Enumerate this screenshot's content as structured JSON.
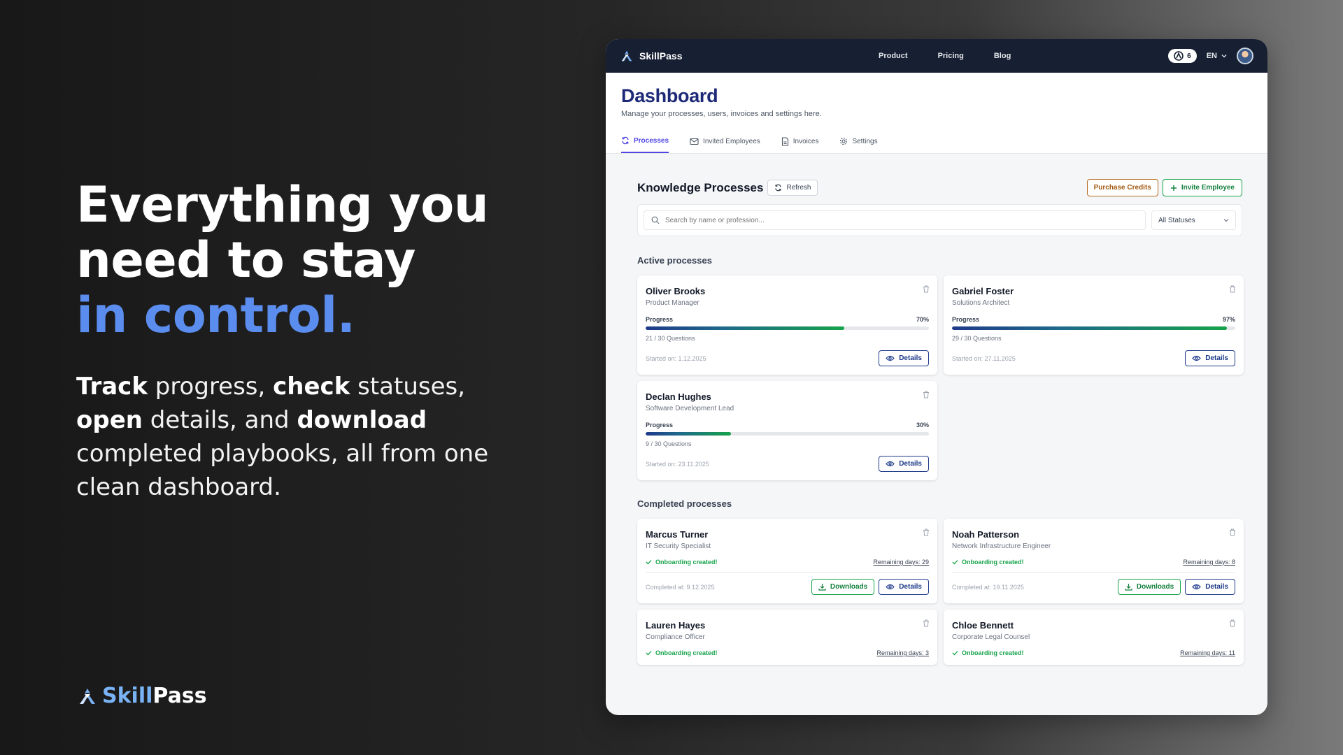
{
  "hero": {
    "line1": "Everything you",
    "line2": "need to stay",
    "line3": "in control.",
    "description": [
      {
        "text": "Track",
        "bold": true
      },
      {
        "text": " progress, ",
        "bold": false
      },
      {
        "text": "check",
        "bold": true
      },
      {
        "text": " statuses, ",
        "bold": false
      },
      {
        "text": "open",
        "bold": true
      },
      {
        "text": " details, and ",
        "bold": false
      },
      {
        "text": "download",
        "bold": true
      },
      {
        "text": " completed playbooks, all from one clean dashboard.",
        "bold": false
      }
    ]
  },
  "brand": {
    "skill": "Skill",
    "pass": "Pass",
    "full": "SkillPass"
  },
  "topbar": {
    "nav": [
      "Product",
      "Pricing",
      "Blog"
    ],
    "credits": "6",
    "language": "EN"
  },
  "dashboard": {
    "title": "Dashboard",
    "subtitle": "Manage your processes, users, invoices and settings here.",
    "tabs": [
      {
        "label": "Processes",
        "icon": "refresh-icon",
        "active": true
      },
      {
        "label": "Invited Employees",
        "icon": "mail-icon",
        "active": false
      },
      {
        "label": "Invoices",
        "icon": "document-icon",
        "active": false
      },
      {
        "label": "Settings",
        "icon": "gear-icon",
        "active": false
      }
    ]
  },
  "knowledge": {
    "title": "Knowledge Processes",
    "refresh_label": "Refresh",
    "purchase_label": "Purchase Credits",
    "invite_label": "Invite Employee",
    "search_placeholder": "Search by name or profession...",
    "status_filter": "All Statuses"
  },
  "labels": {
    "active_section": "Active processes",
    "completed_section": "Completed processes",
    "progress": "Progress",
    "details": "Details",
    "downloads": "Downloads",
    "onboarding": "Onboarding created!"
  },
  "active": [
    {
      "name": "Oliver Brooks",
      "role": "Product Manager",
      "percent": "70%",
      "progress": 70,
      "questions": "21 / 30 Questions",
      "started": "Started on: 1.12.2025"
    },
    {
      "name": "Gabriel Foster",
      "role": "Solutions Architect",
      "percent": "97%",
      "progress": 97,
      "questions": "29 / 30 Questions",
      "started": "Started on: 27.11.2025"
    },
    {
      "name": "Declan Hughes",
      "role": "Software Development Lead",
      "percent": "30%",
      "progress": 30,
      "questions": "9 / 30 Questions",
      "started": "Started on: 23.11.2025"
    }
  ],
  "completed": [
    {
      "name": "Marcus Turner",
      "role": "IT Security Specialist",
      "remaining": "Remaining days: 29",
      "completed": "Completed at: 9.12.2025"
    },
    {
      "name": "Noah Patterson",
      "role": "Network Infrastructure Engineer",
      "remaining": "Remaining days: 8",
      "completed": "Completed at: 19.11.2025"
    },
    {
      "name": "Lauren Hayes",
      "role": "Compliance Officer",
      "remaining": "Remaining days: 3",
      "completed": ""
    },
    {
      "name": "Chloe Bennett",
      "role": "Corporate Legal Counsel",
      "remaining": "Remaining days: 11",
      "completed": ""
    }
  ],
  "colors": {
    "accent": "#5b8def",
    "navy": "#172033",
    "title": "#1e2a78",
    "green": "#16a34a",
    "orange": "#b4691f"
  }
}
